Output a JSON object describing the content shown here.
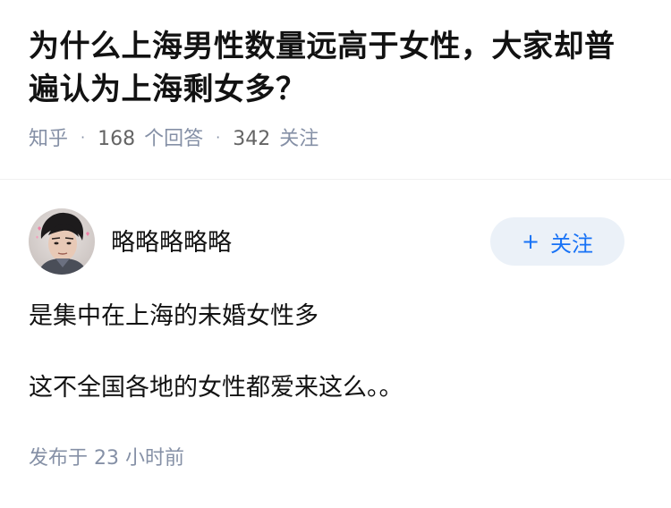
{
  "question": {
    "title": "为什么上海男性数量远高于女性，大家却普遍认为上海剩女多？",
    "source": "知乎",
    "answer_count": "168",
    "answer_label": "个回答",
    "follower_count": "342",
    "follower_label": "关注"
  },
  "answer": {
    "author_name": "略略略略略",
    "follow_label": "关注",
    "follow_plus": "+",
    "paragraphs": [
      "是集中在上海的未婚女性多",
      "这不全国各地的女性都爱来这么。。"
    ],
    "time_label": "发布于",
    "time_value": "23 小时前"
  },
  "colors": {
    "meta_gray": "#8590a6",
    "accent_blue": "#1772f6",
    "follow_bg": "#ebf1f8"
  }
}
